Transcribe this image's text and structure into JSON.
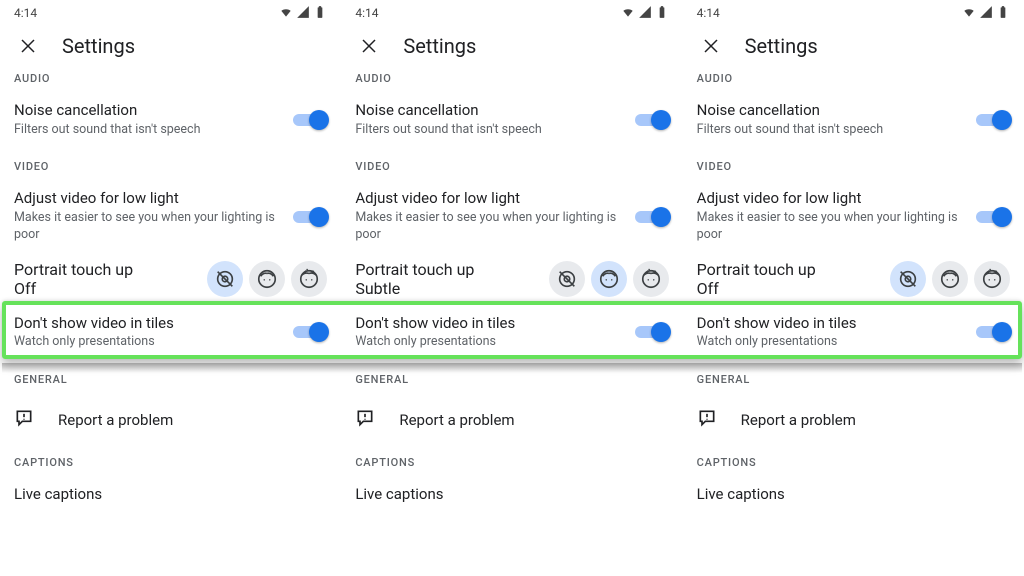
{
  "status": {
    "time": "4:14"
  },
  "header": {
    "title": "Settings"
  },
  "sections": {
    "audio": "AUDIO",
    "video": "VIDEO",
    "general": "GENERAL",
    "captions": "CAPTIONS"
  },
  "settings": {
    "noise": {
      "title": "Noise cancellation",
      "desc": "Filters out sound that isn't speech"
    },
    "lowlight": {
      "title": "Adjust video for low light",
      "desc": "Makes it easier to see you when your lighting is poor"
    },
    "portrait": {
      "title": "Portrait touch up"
    },
    "tiles": {
      "title": "Don't show video in tiles",
      "desc": "Watch only presentations"
    },
    "report": {
      "title": "Report a problem"
    },
    "captions": {
      "title": "Live captions"
    }
  },
  "panels": [
    {
      "portrait_value": "Off",
      "portrait_selected": 0
    },
    {
      "portrait_value": "Subtle",
      "portrait_selected": 1
    },
    {
      "portrait_value": "Off",
      "portrait_selected": 0
    }
  ]
}
